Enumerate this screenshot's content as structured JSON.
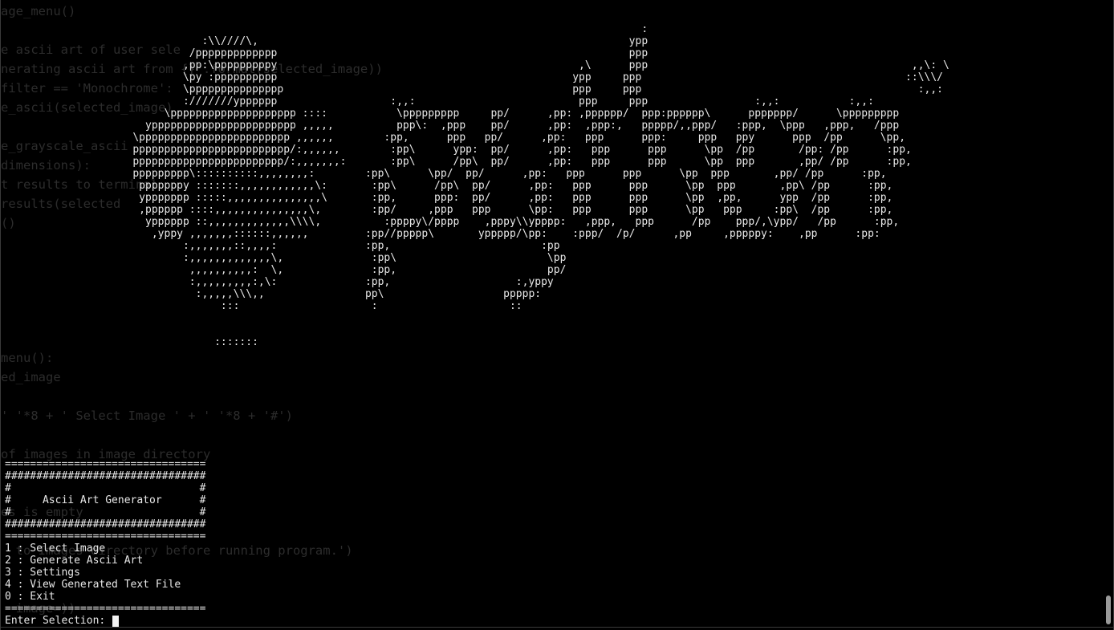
{
  "ghost_editor_lines": [
    "age_menu()",
    "",
    "e ascii art of user sele",
    "nerating ascii art from {}'.format(selected_image))",
    "filter == 'Monochrome':",
    "e_ascii(selected_image)",
    "",
    "e_grayscale_ascii",
    "dimensions):",
    "t results to terminal",
    "results(selected",
    "()",
    "",
    "",
    "",
    "",
    "",
    "",
    "menu():",
    "ed_image",
    "",
    "' '*8 + ' Select Image ' + ' '*8 + '#')",
    "",
    "of images in image directory",
    "",
    "",
    "es is empty",
    "",
    "  to Images directory before running program.')",
    "",
    "",
    "  image=))"
  ],
  "ascii_art_lines": [
    "                                                                                                      :",
    "                                :\\\\////\\,                                                           ypp",
    "                              /ppppppppppppp                                                        ppp",
    "                             ,pp:\\pppppppppy                                                ,\\      ppp                                          ,,\\: \\",
    "                             \\py :pppppppppp                                               ypp     ppp                                          ::\\\\\\/",
    "                             \\ppppppppppppppp                                              ppp     ppp                                            :,,:",
    "                             :///////ypppppp                  :,,:                          ppp     ppp                 :,,:           :,,:",
    "                          \\pppppppppppppppppppp ::::           \\ppppppppp     pp/      ,pp: ,pppppp/  ppp:pppppp\\      ppppppp/      \\ppppppppp",
    "                       yppppppppppppppppppppppp ,,,,,          ppp\\:  ,ppp    pp/      ,pp:  ,ppp:,   ppppp/,,ppp/   :ppp,  \\ppp   ,ppp,   /ppp",
    "                     \\pppppppppppppppppppppppp ,,,,,,        :pp,      ppp   pp/      ,pp:   ppp      ppp:     ppp   ppy      ppp  /pp      \\pp,",
    "                     ppppppppppppppppppppppppp/:,,,,,,        :pp\\      ypp:  pp/      ,pp:   ppp      ppp      \\pp  /pp       /pp: /pp      :pp,",
    "                     pppppppppppppppppppppppp/:,,,,,,,:       :pp\\      /pp\\  pp/      ,pp:   ppp      ppp      \\pp  ppp       ,pp/ /pp      :pp,",
    "                     ppppppppp\\::::::::::,,,,,,,,:        :pp\\      \\pp/  pp/      ,pp:   ppp      ppp      \\pp  ppp       ,pp/ /pp      :pp,",
    "                      pppppppy :::::::,,,,,,,,,,,,\\:       :pp\\      /pp\\  pp/      ,pp:   ppp      ppp      \\pp  ppp       ,pp\\ /pp      :pp,",
    "                      yppppppp :::::,,,,,,,,,,,,,,,\\       :pp,      ppp:  pp/      ,pp:   ppp      ppp      \\pp  ,pp,      ypp  /pp      :pp,",
    "                      ,pppppp ::::,,,,,,,,,,,,,,,\\,        :pp/     ,ppp   ppp      \\pp:   ppp      ppp      \\pp   ppp     :pp\\  /pp      :pp,",
    "                       ypppppp ::,,,,,,,,,,,,,\\\\\\\\,          :ppppy\\/pppp    ,pppy\\\\ypppp:   ,ppp,   ppp      /pp    ppp/,\\ypp/   /pp      :pp,",
    "                        ,yppy ,,,,,,,::::::,,,,,,         :pp//ppppp\\       yppppp/\\pp:    :ppp/  /p/      ,pp     ,pppppy:    ,pp      :pp:",
    "                             :,,,,,,,::,,,,:              :pp,                        :pp",
    "                             :,,,,,,,,,,,,,\\,              :pp\\                        \\pp",
    "                              ,,,,,,,,,,:  \\,              :pp,                        pp/",
    "                              :,,,,,,,,,:,\\:              :pp,                    :,yppy",
    "                               :,,,,,\\\\\\,,                pp\\                   ppppp:",
    "                                   :::                     :                     ::",
    "",
    "",
    "                                  :::::::"
  ],
  "menu": {
    "lines": [
      "================================",
      "################################",
      "#                              #",
      "#     Ascii Art Generator      #",
      "#                              #",
      "################################",
      "================================",
      "1 : Select Image",
      "2 : Generate Ascii Art",
      "3 : Settings",
      "4 : View Generated Text File",
      "0 : Exit",
      "================================"
    ],
    "prompt": "Enter Selection: "
  },
  "colors": {
    "background": "#000000",
    "foreground": "#e8e8e8",
    "ghost_text": "#2c2c2c",
    "cursor": "#f2f2f2",
    "scrollbar": "#9a9a9a"
  }
}
